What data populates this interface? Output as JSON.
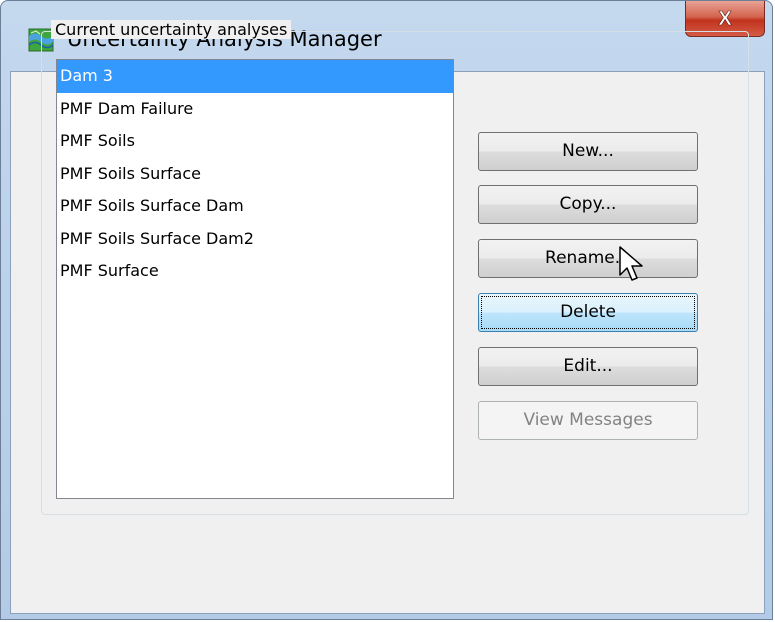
{
  "window": {
    "title": "Uncertainty Analysis Manager",
    "close_glyph": "X"
  },
  "group": {
    "label": "Current uncertainty analyses"
  },
  "analyses": [
    "Dam 3",
    "PMF Dam Failure",
    "PMF Soils",
    "PMF Soils Surface",
    "PMF Soils Surface Dam",
    "PMF Soils Surface Dam2",
    "PMF Surface"
  ],
  "selected_analysis": "Dam 3",
  "buttons": {
    "new": "New...",
    "copy": "Copy...",
    "rename": "Rename...",
    "delete": "Delete",
    "edit": "Edit...",
    "view_messages": "View Messages"
  },
  "icons": {
    "app": "app-icon",
    "close": "close-icon",
    "cursor": "mouse-pointer-icon"
  },
  "colors": {
    "selection": "#3399ff",
    "close_button": "#c8412f",
    "focused_button": "#bee6fd"
  }
}
